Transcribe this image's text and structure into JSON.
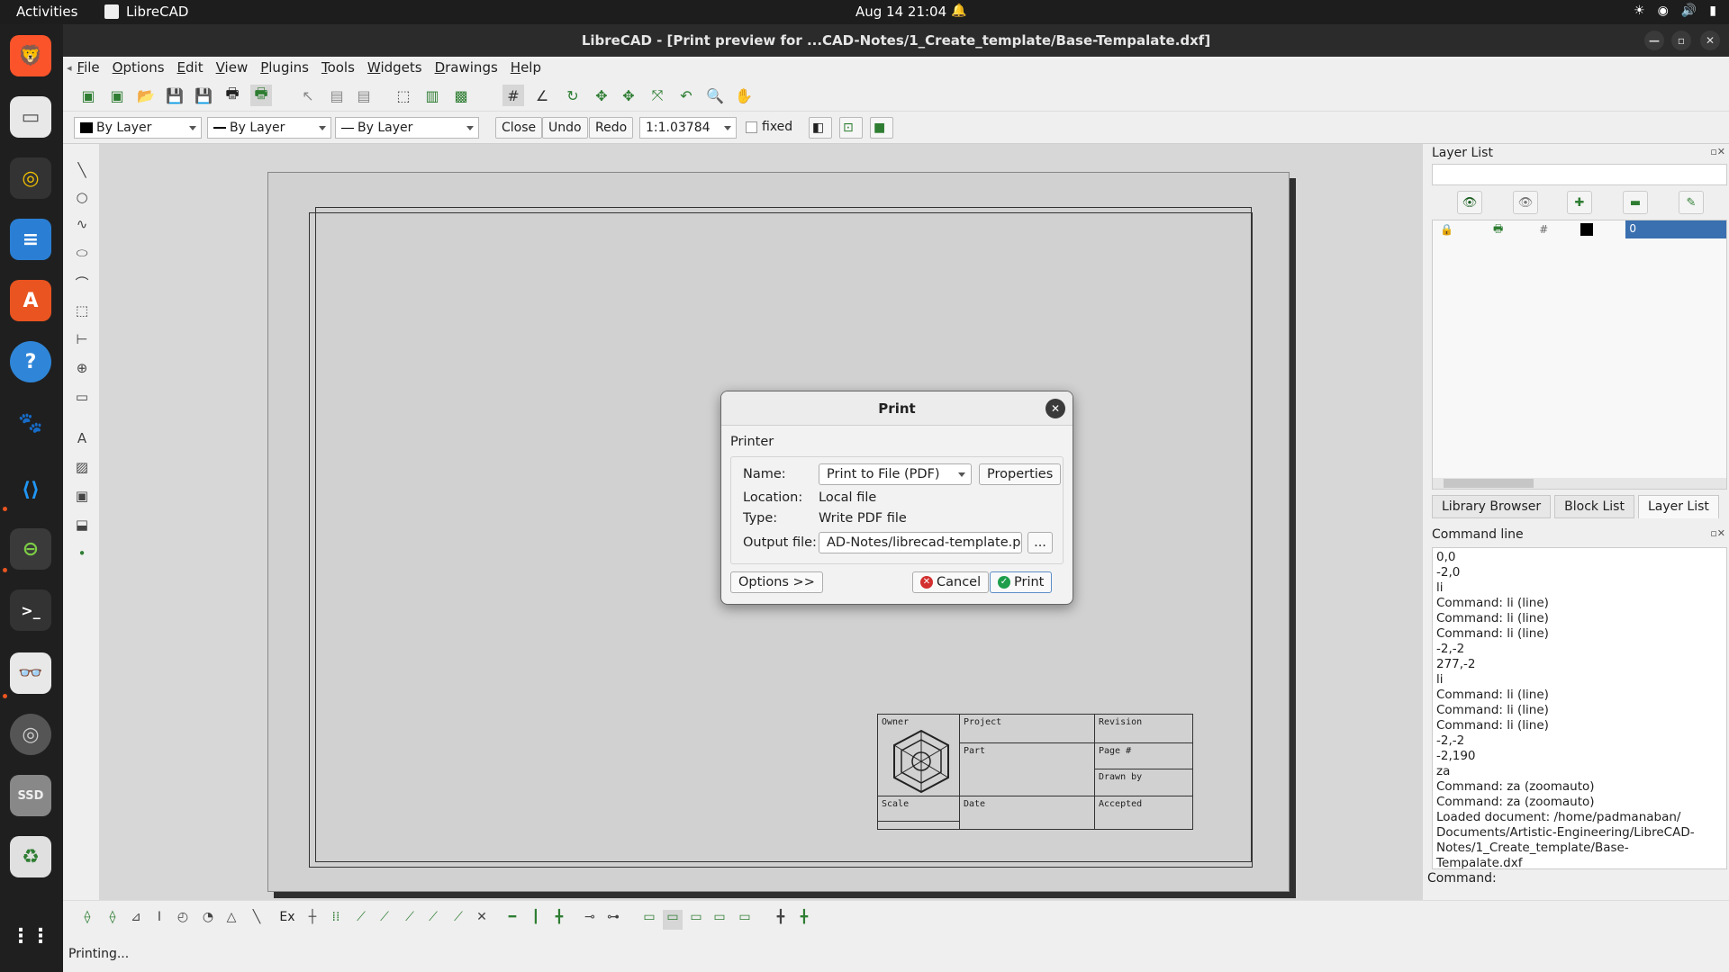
{
  "topbar": {
    "activities": "Activities",
    "app_name": "LibreCAD",
    "clock": "Aug 14  21:04"
  },
  "window": {
    "title": "LibreCAD - [Print preview for ...CAD-Notes/1_Create_template/Base-Tempalate.dxf]"
  },
  "menu": [
    "File",
    "Options",
    "Edit",
    "View",
    "Plugins",
    "Tools",
    "Widgets",
    "Drawings",
    "Help"
  ],
  "toolbar2": {
    "color": "By Layer",
    "linetype": "By Layer",
    "linewidth": "By Layer",
    "close": "Close",
    "undo": "Undo",
    "redo": "Redo",
    "scale": "1:1.03784",
    "fixed": "fixed"
  },
  "titleblock": {
    "owner": "Owner",
    "project": "Project",
    "revision": "Revision",
    "part": "Part",
    "page": "Page #",
    "drawn_by": "Drawn by",
    "scale": "Scale",
    "date": "Date",
    "accepted": "Accepted"
  },
  "layer_panel": {
    "title": "Layer List",
    "layer_name": "0"
  },
  "tabs": [
    "Library Browser",
    "Block List",
    "Layer List"
  ],
  "command_panel": {
    "title": "Command line",
    "lines": [
      "0,0",
      "-2,0",
      "li",
      "Command: li (line)",
      "Command: li (line)",
      "Command: li (line)",
      "-2,-2",
      "277,-2",
      "li",
      "Command: li (line)",
      "Command: li (line)",
      "Command: li (line)",
      "-2,-2",
      "-2,190",
      "za",
      "Command: za (zoomauto)",
      "Command: za (zoomauto)",
      "Loaded document: /home/padmanaban/",
      "Documents/Artistic-Engineering/LibreCAD-",
      "Notes/1_Create_template/Base-",
      "Tempalate.dxf"
    ],
    "prompt": "Command:"
  },
  "status": "Printing...",
  "dialog": {
    "title": "Print",
    "group": "Printer",
    "name_label": "Name:",
    "name_value": "Print to File (PDF)",
    "properties": "Properties",
    "location_label": "Location:",
    "location_value": "Local file",
    "type_label": "Type:",
    "type_value": "Write PDF file",
    "output_label": "Output file:",
    "output_value": "AD-Notes/librecad-template.pdf",
    "browse": "...",
    "options": "Options >>",
    "cancel": "Cancel",
    "print": "Print"
  },
  "colors": {
    "accent": "#e95420",
    "layer_selected": "#3a6fb0",
    "ok_green": "#1e9e4a",
    "cancel_red": "#d32f2f"
  }
}
